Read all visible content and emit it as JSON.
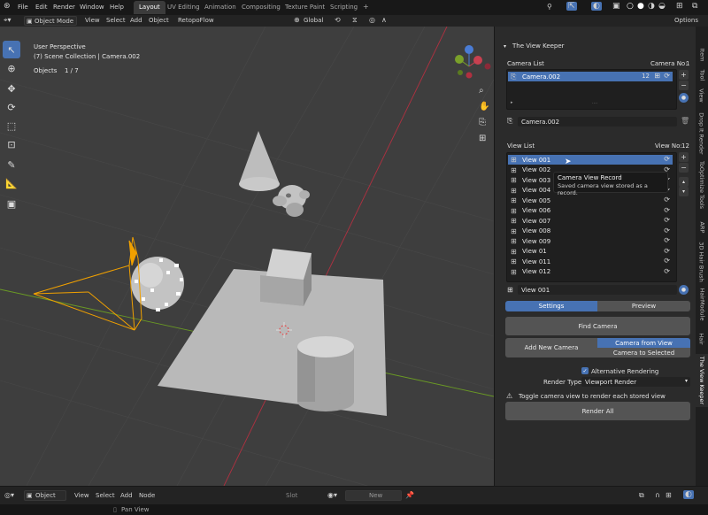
{
  "topbar": {
    "menus": [
      "File",
      "Edit",
      "Render",
      "Window",
      "Help"
    ],
    "workspaces": [
      "Layout",
      "UV Editing",
      "Animation",
      "Compositing",
      "Texture Paint",
      "Scripting"
    ],
    "add_tab": "+"
  },
  "header": {
    "mode": "Object Mode",
    "menus": [
      "View",
      "Select",
      "Add",
      "Object"
    ],
    "addon": "RetopoFlow",
    "transform": "Global",
    "options": "Options"
  },
  "viewport": {
    "perspective": "User Perspective",
    "collection": "(7) Scene Collection | Camera.002",
    "objects_label": "Objects",
    "objects_count": "1 / 7"
  },
  "panel": {
    "title": "The View Keeper",
    "camera_list_label": "Camera List",
    "camera_no_label": "Camera No:",
    "camera_no": "1",
    "camera_rows": [
      {
        "name": "Camera.002",
        "count": "12"
      }
    ],
    "camera_field": "Camera.002",
    "view_list_label": "View List",
    "view_no_label": "View No:",
    "view_no": "12",
    "views": [
      "View 001",
      "View 002",
      "View 003",
      "View 004",
      "View 005",
      "View 006",
      "View 007",
      "View 008",
      "View 009",
      "View 01",
      "View 011",
      "View 012"
    ],
    "view_field": "View 001",
    "tab_settings": "Settings",
    "tab_preview": "Preview",
    "find_camera": "Find Camera",
    "add_new_camera": "Add New Camera",
    "camera_from_view": "Camera from View",
    "camera_to_selected": "Camera to Selected",
    "alt_rendering": "Alternative Rendering",
    "render_type_label": "Render Type",
    "render_type_value": "Viewport Render",
    "warning": "Toggle camera view to render each stored view",
    "render_all": "Render All"
  },
  "tooltip": {
    "title": "Camera View Record",
    "body": "Saved camera view stored as a record."
  },
  "side_tabs": [
    "Item",
    "Tool",
    "View",
    "Drop It Render",
    "ToOptimize Tools",
    "ARP",
    "3D Hair Brush",
    "HairModule",
    "Hair",
    "The View Keeper"
  ],
  "bottombar": {
    "mode": "Object",
    "menus": [
      "View",
      "Select",
      "Add",
      "Node"
    ],
    "slot": "Slot",
    "new": "New"
  },
  "statusbar": {
    "hint": "Pan View"
  },
  "colors": {
    "accent": "#4772b3",
    "camera": "#f0a000",
    "axis_x": "#b03040",
    "axis_y": "#6a9a24"
  }
}
